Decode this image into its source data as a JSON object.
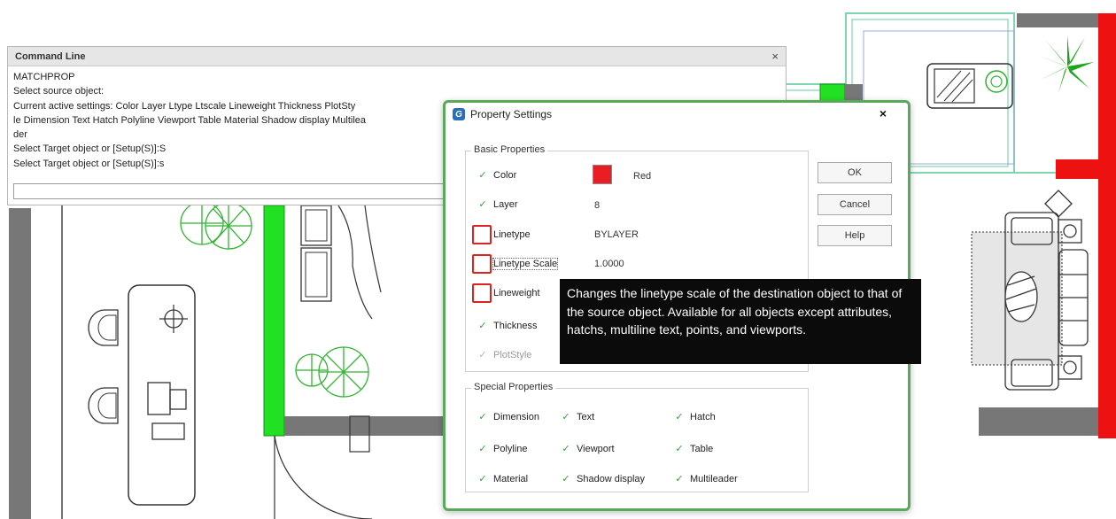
{
  "command_line": {
    "title": "Command Line",
    "close_glyph": "×",
    "history": [
      "MATCHPROP",
      "Select source object:",
      "Current active settings:  Color Layer Ltype Ltscale Lineweight Thickness PlotSty",
      "le Dimension Text Hatch Polyline Viewport Table Material Shadow display Multilea",
      "der",
      "Select Target object or [Setup(S)]:S",
      "Select Target object or [Setup(S)]:s"
    ],
    "input_value": ""
  },
  "dialog": {
    "title": "Property Settings",
    "close_glyph": "×",
    "basic_group": "Basic Properties",
    "basic": [
      {
        "label": "Color",
        "checked": true,
        "value": "Red"
      },
      {
        "label": "Layer",
        "checked": true,
        "value": "8"
      },
      {
        "label": "Linetype",
        "checked": false,
        "value": "BYLAYER"
      },
      {
        "label": "Linetype Scale",
        "checked": false,
        "value": "1.0000"
      },
      {
        "label": "Lineweight",
        "checked": false,
        "value": ""
      },
      {
        "label": "Thickness",
        "checked": true,
        "value": ""
      },
      {
        "label": "PlotStyle",
        "checked": true,
        "value": ""
      }
    ],
    "buttons": {
      "ok": "OK",
      "cancel": "Cancel",
      "help": "Help"
    },
    "special_group": "Special Properties",
    "special": [
      {
        "label": "Dimension",
        "checked": true
      },
      {
        "label": "Text",
        "checked": true
      },
      {
        "label": "Hatch",
        "checked": true
      },
      {
        "label": "Polyline",
        "checked": true
      },
      {
        "label": "Viewport",
        "checked": true
      },
      {
        "label": "Table",
        "checked": true
      },
      {
        "label": "Material",
        "checked": true
      },
      {
        "label": "Shadow display",
        "checked": true
      },
      {
        "label": "Multileader",
        "checked": true
      }
    ],
    "check_glyph": "✓",
    "color_swatch": "#ea1c24"
  },
  "tooltip": {
    "text": "Changes the linetype scale of the destination object to that of the source object. Available for all objects except attributes, hatchs, multiline text, points, and viewports."
  },
  "colors": {
    "green_wall": "#22e022",
    "red_wall": "#ee1111",
    "plant_green": "#2fb52f",
    "dialog_border": "#5aa85a"
  }
}
